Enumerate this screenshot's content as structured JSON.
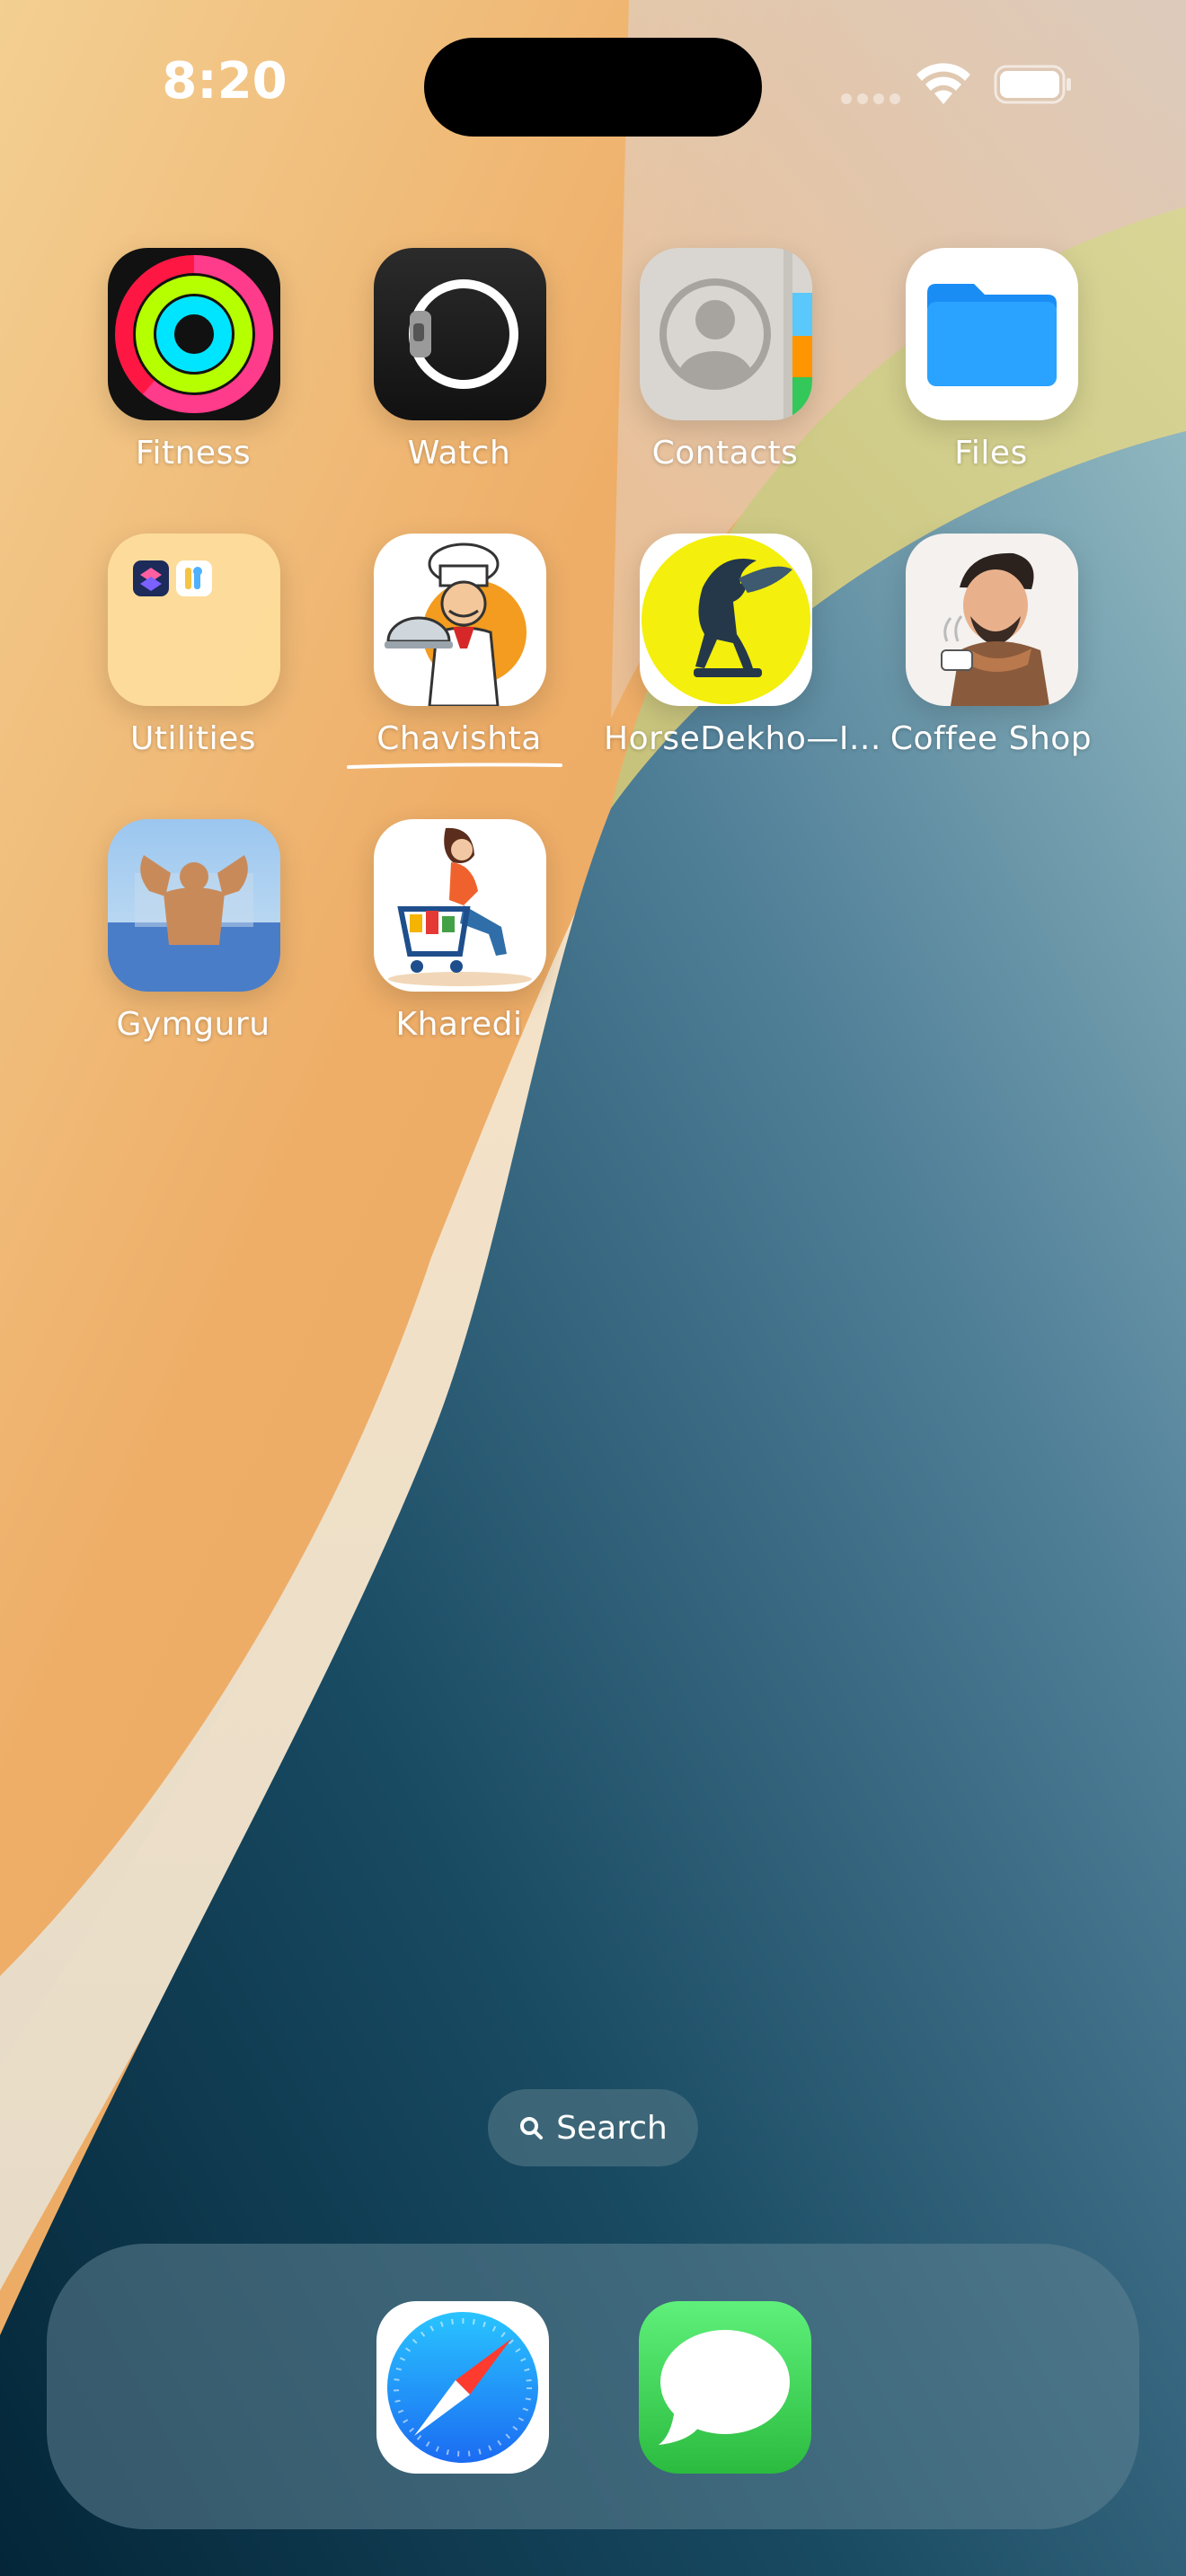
{
  "status_bar": {
    "time": "8:20"
  },
  "apps": [
    {
      "label": "Fitness",
      "icon": "fitness-rings-icon"
    },
    {
      "label": "Watch",
      "icon": "watch-icon"
    },
    {
      "label": "Contacts",
      "icon": "contacts-icon"
    },
    {
      "label": "Files",
      "icon": "folder-icon"
    },
    {
      "label": "Utilities",
      "icon": "folder-group-icon"
    },
    {
      "label": "Chavishta",
      "icon": "chef-icon"
    },
    {
      "label": "HorseDekho—I...",
      "icon": "horse-icon"
    },
    {
      "label": "Coffee Shop",
      "icon": "coffee-man-icon"
    },
    {
      "label": "Gymguru",
      "icon": "bodybuilder-icon"
    },
    {
      "label": "Kharedi",
      "icon": "shopping-cart-icon"
    }
  ],
  "search": {
    "label": "Search",
    "icon": "search-icon"
  },
  "dock": [
    {
      "name": "Safari",
      "icon": "compass-icon"
    },
    {
      "name": "Messages",
      "icon": "speech-bubble-icon"
    }
  ],
  "colors": {
    "accent": "#1a8df5",
    "messages_green": "#34c759"
  }
}
